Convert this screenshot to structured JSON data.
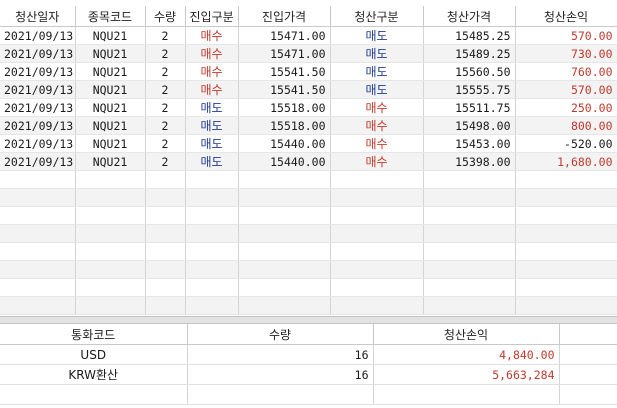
{
  "trades": {
    "headers": [
      "청산일자",
      "종목코드",
      "수량",
      "진입구분",
      "진입가격",
      "청산구분",
      "청산가격",
      "청산손익"
    ],
    "rows": [
      {
        "date": "2021/09/13",
        "code": "NQU21",
        "qty": "2",
        "entry_side": "매수",
        "entry_price": "15471.00",
        "exit_side": "매도",
        "exit_price": "15485.25",
        "pnl": "570.00"
      },
      {
        "date": "2021/09/13",
        "code": "NQU21",
        "qty": "2",
        "entry_side": "매수",
        "entry_price": "15471.00",
        "exit_side": "매도",
        "exit_price": "15489.25",
        "pnl": "730.00"
      },
      {
        "date": "2021/09/13",
        "code": "NQU21",
        "qty": "2",
        "entry_side": "매수",
        "entry_price": "15541.50",
        "exit_side": "매도",
        "exit_price": "15560.50",
        "pnl": "760.00"
      },
      {
        "date": "2021/09/13",
        "code": "NQU21",
        "qty": "2",
        "entry_side": "매수",
        "entry_price": "15541.50",
        "exit_side": "매도",
        "exit_price": "15555.75",
        "pnl": "570.00"
      },
      {
        "date": "2021/09/13",
        "code": "NQU21",
        "qty": "2",
        "entry_side": "매도",
        "entry_price": "15518.00",
        "exit_side": "매수",
        "exit_price": "15511.75",
        "pnl": "250.00"
      },
      {
        "date": "2021/09/13",
        "code": "NQU21",
        "qty": "2",
        "entry_side": "매도",
        "entry_price": "15518.00",
        "exit_side": "매수",
        "exit_price": "15498.00",
        "pnl": "800.00"
      },
      {
        "date": "2021/09/13",
        "code": "NQU21",
        "qty": "2",
        "entry_side": "매도",
        "entry_price": "15440.00",
        "exit_side": "매수",
        "exit_price": "15453.00",
        "pnl": "-520.00"
      },
      {
        "date": "2021/09/13",
        "code": "NQU21",
        "qty": "2",
        "entry_side": "매도",
        "entry_price": "15440.00",
        "exit_side": "매수",
        "exit_price": "15398.00",
        "pnl": "1,680.00"
      }
    ]
  },
  "summary": {
    "headers": [
      "통화코드",
      "수량",
      "청산손익"
    ],
    "rows": [
      {
        "currency": "USD",
        "qty": "16",
        "pnl": "4,840.00"
      },
      {
        "currency": "KRW환산",
        "qty": "16",
        "pnl": "5,663,284"
      }
    ]
  },
  "colors": {
    "buy_text": "#c0392b",
    "sell_text": "#1f3a93",
    "profit_text": "#c0392b",
    "loss_text": "#1a1a1a",
    "alt_row_bg": "#f3f3f3"
  }
}
